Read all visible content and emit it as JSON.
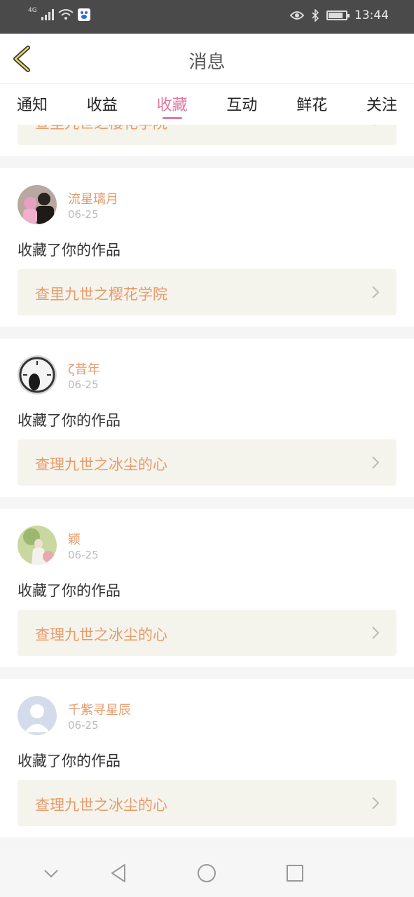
{
  "status_bar": {
    "network": "4G",
    "time": "13:44"
  },
  "header": {
    "title": "消息"
  },
  "tabs": [
    {
      "label": "通知",
      "active": false
    },
    {
      "label": "收益",
      "active": false
    },
    {
      "label": "收藏",
      "active": true
    },
    {
      "label": "互动",
      "active": false
    },
    {
      "label": "鲜花",
      "active": false
    },
    {
      "label": "关注",
      "active": false
    }
  ],
  "feed": {
    "partial_link": "查里九世之樱花学院",
    "items": [
      {
        "user": "流星璃月",
        "date": "06-25",
        "action": "收藏了你的作品",
        "work": "查里九世之樱花学院"
      },
      {
        "user": "ζ昔年",
        "date": "06-25",
        "action": "收藏了你的作品",
        "work": "查理九世之冰尘的心"
      },
      {
        "user": "颖",
        "date": "06-25",
        "action": "收藏了你的作品",
        "work": "查理九世之冰尘的心"
      },
      {
        "user": "千紫寻星辰",
        "date": "06-25",
        "action": "收藏了你的作品",
        "work": "查理九世之冰尘的心"
      }
    ]
  },
  "colors": {
    "accent": "#e07aa0",
    "link": "#e89a6a",
    "status_bar": "#4a4a4a"
  }
}
